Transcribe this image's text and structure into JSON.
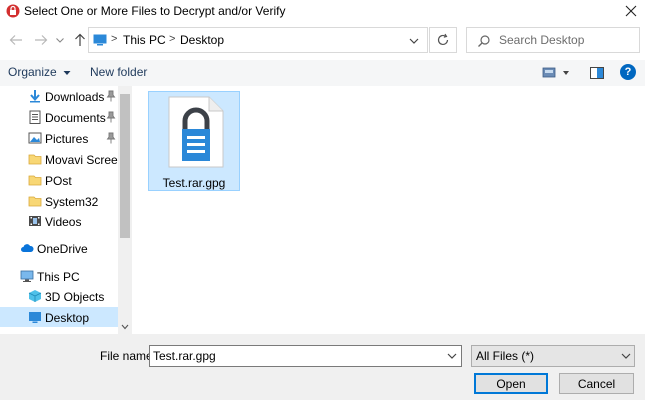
{
  "window": {
    "title": "Select One or More Files to Decrypt and/or Verify",
    "app_icon": "kleopatra-icon",
    "close_icon": "close-icon"
  },
  "nav": {
    "back_icon": "arrow-left-icon",
    "forward_icon": "arrow-right-icon",
    "recent_icon": "chevron-down-icon",
    "up_icon": "arrow-up-icon",
    "address": {
      "segments": [
        "This PC",
        "Desktop"
      ],
      "separator": ">"
    },
    "refresh_icon": "refresh-icon",
    "search": {
      "placeholder": "Search Desktop",
      "value": ""
    }
  },
  "toolbar": {
    "organize_label": "Organize",
    "new_folder_label": "New folder",
    "help_label": "?"
  },
  "sidebar": {
    "items": [
      {
        "label": "Downloads",
        "icon": "download-arrow-icon",
        "pinned": true
      },
      {
        "label": "Documents",
        "icon": "documents-icon",
        "pinned": true
      },
      {
        "label": "Pictures",
        "icon": "pictures-icon",
        "pinned": true
      },
      {
        "label": "Movavi Screen C",
        "icon": "folder-icon",
        "pinned": false
      },
      {
        "label": "POst",
        "icon": "folder-icon",
        "pinned": false
      },
      {
        "label": "System32",
        "icon": "folder-icon",
        "pinned": false
      },
      {
        "label": "Videos",
        "icon": "videos-icon",
        "pinned": false
      },
      {
        "label": "OneDrive",
        "icon": "cloud-icon",
        "pinned": false
      },
      {
        "label": "This PC",
        "icon": "computer-icon",
        "pinned": false
      },
      {
        "label": "3D Objects",
        "icon": "cube-icon",
        "pinned": false
      },
      {
        "label": "Desktop",
        "icon": "desktop-icon",
        "pinned": false,
        "selected": true
      }
    ]
  },
  "content": {
    "files": [
      {
        "name": "Test.rar.gpg",
        "icon": "encrypted-file-icon",
        "selected": true
      }
    ]
  },
  "bottom": {
    "filename_label": "File name:",
    "filename_value": "Test.rar.gpg",
    "filetype_value": "All Files (*)",
    "open_label": "Open",
    "cancel_label": "Cancel"
  },
  "colors": {
    "accent": "#0078d7",
    "selection": "#cce8ff",
    "icon_blue": "#2b88d8",
    "lock_dark": "#3c4148"
  }
}
